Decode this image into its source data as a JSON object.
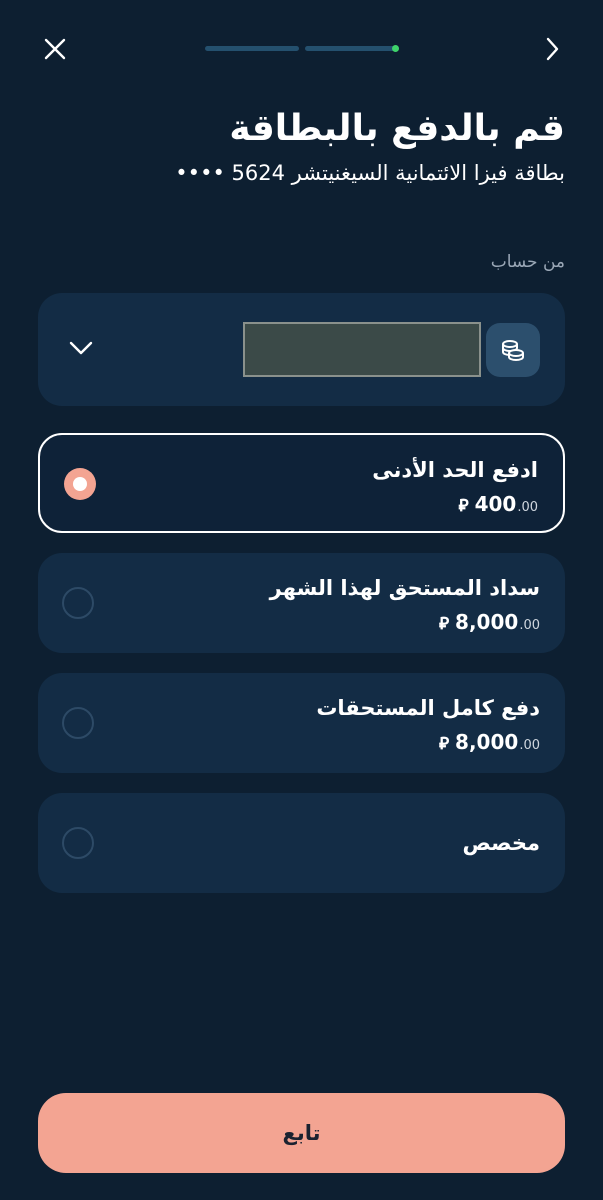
{
  "header": {
    "close_icon": "close-icon",
    "forward_icon": "chevron-right-icon",
    "progress_accent": "#3ed36a"
  },
  "title": "قم بالدفع بالبطاقة",
  "subtitle": "بطاقة فيزا الائتمانية السيغنيتشر 5624 ••••",
  "section_label": "من حساب",
  "account": {
    "icon": "coins-icon",
    "name_redacted": true,
    "dropdown_icon": "chevron-down-icon"
  },
  "options": [
    {
      "title": "ادفع الحد الأدنى",
      "amount": "400",
      "decimals": ".00",
      "currency_symbol": "⃁",
      "selected": true
    },
    {
      "title": "سداد المستحق لهذا الشهر",
      "amount": "8,000",
      "decimals": ".00",
      "currency_symbol": "⃁",
      "selected": false
    },
    {
      "title": "دفع كامل المستحقات",
      "amount": "8,000",
      "decimals": ".00",
      "currency_symbol": "⃁",
      "selected": false
    },
    {
      "title": "مخصص",
      "selected": false
    }
  ],
  "continue_label": "تابع",
  "colors": {
    "background": "#0d1f31",
    "card": "#132c45",
    "accent": "#f3a492"
  }
}
